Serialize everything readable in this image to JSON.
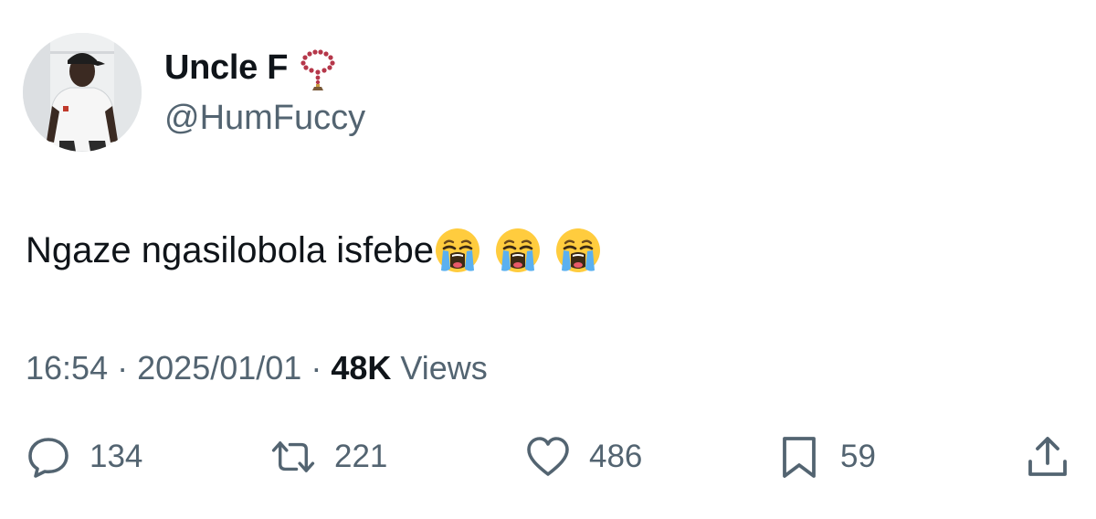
{
  "user": {
    "display_name": "Uncle F",
    "badge_icon": "rosary-icon",
    "handle": "@HumFuccy"
  },
  "tweet": {
    "text": "Ngaze ngasilobola isfebe",
    "emojis": [
      "loudly-crying-face",
      "loudly-crying-face",
      "loudly-crying-face"
    ]
  },
  "meta": {
    "time": "16:54",
    "separator": "·",
    "date": "2025/01/01",
    "views_count": "48K",
    "views_label": "Views"
  },
  "actions": {
    "replies": "134",
    "retweets": "221",
    "likes": "486",
    "bookmarks": "59"
  },
  "colors": {
    "text": "#0f1419",
    "secondary": "#536471",
    "background": "#ffffff"
  }
}
